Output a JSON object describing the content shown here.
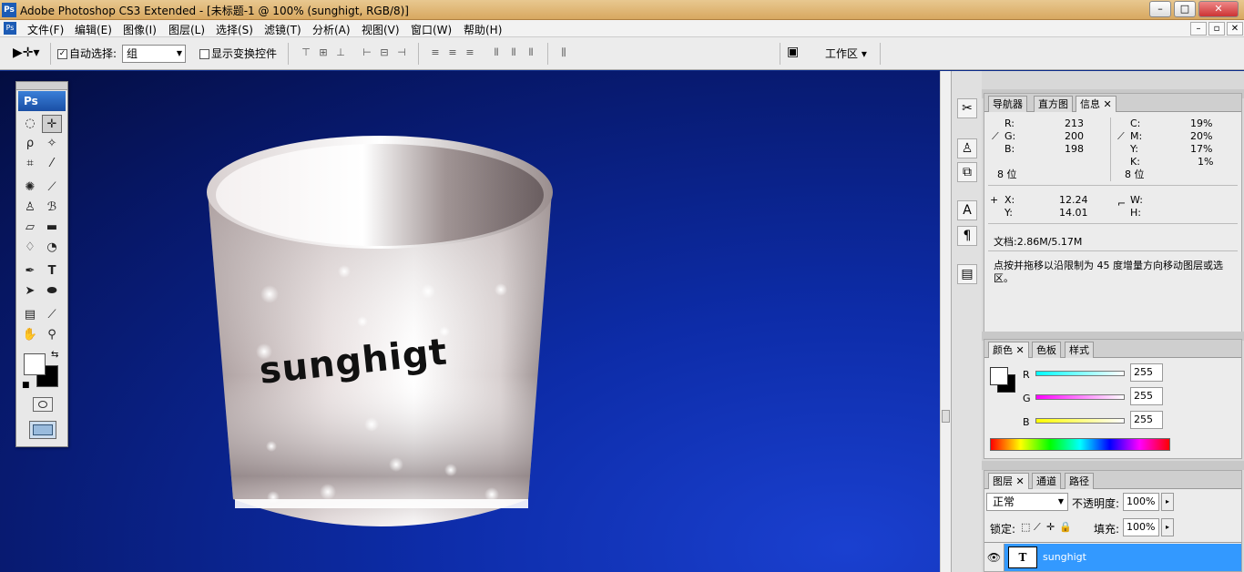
{
  "titlebar": {
    "logo": "Ps",
    "title": "Adobe Photoshop CS3 Extended - [未标题-1 @ 100% (sunghigt, RGB/8)]",
    "minimize": "–",
    "maximize": "□",
    "close": "✕"
  },
  "menubar": {
    "items": [
      "文件(F)",
      "编辑(E)",
      "图像(I)",
      "图层(L)",
      "选择(S)",
      "滤镜(T)",
      "分析(A)",
      "视图(V)",
      "窗口(W)",
      "帮助(H)"
    ]
  },
  "options": {
    "auto_select_label": "自动选择:",
    "auto_select_value": "组",
    "show_transform_label": "显示变换控件",
    "workspace_label": "工作区 ▾"
  },
  "toolbox": {
    "logo": "Ps"
  },
  "canvas": {
    "cup_text": "sunghigt"
  },
  "info_panel": {
    "tabs": [
      "导航器",
      "直方图",
      "信息"
    ],
    "r_label": "R:",
    "r_value": "213",
    "g_label": "G:",
    "g_value": "200",
    "b_label": "B:",
    "b_value": "198",
    "c_label": "C:",
    "c_value": "19%",
    "m_label": "M:",
    "m_value": "20%",
    "y_label": "Y:",
    "y_value": "17%",
    "k_label": "K:",
    "k_value": "1%",
    "bit_left": "8 位",
    "bit_right": "8 位",
    "x_label": "X:",
    "x_value": "12.24",
    "yy_label": "Y:",
    "yy_value": "14.01",
    "w_label": "W:",
    "h_label": "H:",
    "doc_size": "文档:2.86M/5.17M",
    "hint": "点按并拖移以沿限制为 45 度增量方向移动图层或选区。"
  },
  "color_panel": {
    "tabs": [
      "颜色",
      "色板",
      "样式"
    ],
    "r_label": "R",
    "r_value": "255",
    "g_label": "G",
    "g_value": "255",
    "b_label": "B",
    "b_value": "255"
  },
  "layers_panel": {
    "tabs": [
      "图层",
      "通道",
      "路径"
    ],
    "blend_mode": "正常",
    "opacity_label": "不透明度:",
    "opacity_value": "100%",
    "lock_label": "锁定:",
    "fill_label": "填充:",
    "fill_value": "100%",
    "layer_name": "sunghigt",
    "layer_thumb": "T"
  },
  "colors": {
    "selection_blue": "#3399ff"
  }
}
